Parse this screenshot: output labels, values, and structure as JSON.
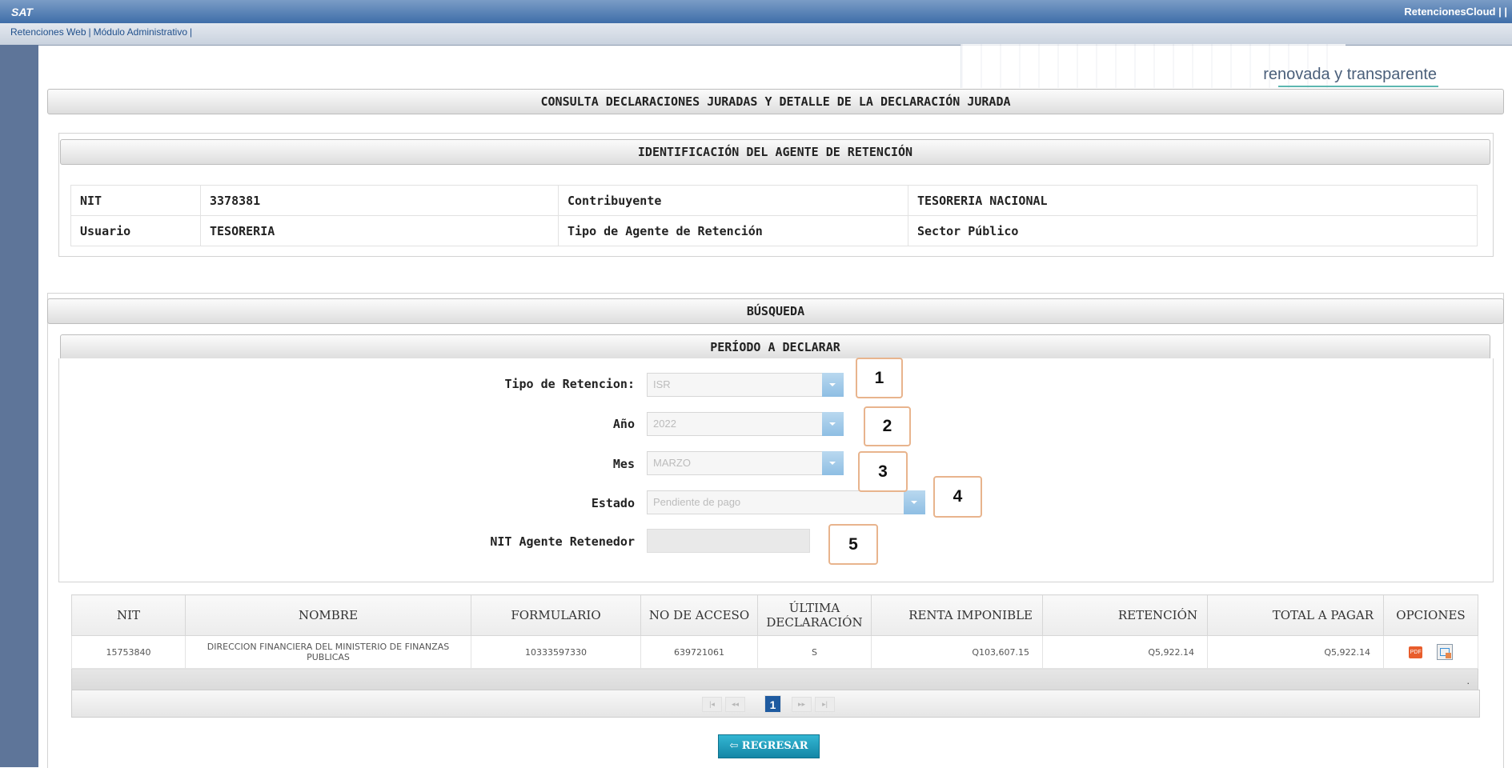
{
  "top": {
    "logo": "SAT",
    "app_name": "RetencionesCloud | |"
  },
  "nav": {
    "items": [
      "Retenciones Web",
      "Módulo Administrativo"
    ]
  },
  "header": {
    "slogan": "renovada y transparente"
  },
  "consulta": {
    "title": "CONSULTA DECLARACIONES JURADAS Y DETALLE DE LA DECLARACIÓN JURADA"
  },
  "identificacion": {
    "title": "IDENTIFICACIÓN DEL AGENTE DE RETENCIÓN",
    "rows": [
      {
        "l1": "NIT",
        "v1": "3378381",
        "l2": "Contribuyente",
        "v2": "TESORERIA NACIONAL"
      },
      {
        "l1": "Usuario",
        "v1": "TESORERIA",
        "l2": "Tipo de Agente de Retención",
        "v2": "Sector Público"
      }
    ]
  },
  "busqueda": {
    "title": "BÚSQUEDA",
    "periodo_title": "PERÍODO A DECLARAR",
    "tipo_label": "Tipo de Retencion:",
    "tipo_value": "ISR",
    "anio_label": "Año",
    "anio_value": "2022",
    "mes_label": "Mes",
    "mes_value": "MARZO",
    "estado_label": "Estado",
    "estado_value": "Pendiente de pago",
    "nit_label": "NIT Agente Retenedor",
    "nit_value": ""
  },
  "badges": [
    "1",
    "2",
    "3",
    "4",
    "5"
  ],
  "results": {
    "headers": [
      "NIT",
      "NOMBRE",
      "FORMULARIO",
      "NO DE ACCESO",
      "ÚLTIMA DECLARACIÓN",
      "RENTA IMPONIBLE",
      "RETENCIÓN",
      "TOTAL A PAGAR",
      "OPCIONES"
    ],
    "rows": [
      {
        "nit": "15753840",
        "nombre": "DIRECCION FINANCIERA DEL MINISTERIO DE FINANZAS PUBLICAS",
        "formulario": "10333597330",
        "acceso": "639721061",
        "ultima": "S",
        "renta": "Q103,607.15",
        "retencion": "Q5,922.14",
        "total": "Q5,922.14"
      }
    ],
    "footer_dot": "."
  },
  "pager": {
    "first": "|◂",
    "prev": "◂◂",
    "current": "1",
    "next": "▸▸",
    "last": "▸|"
  },
  "icons": {
    "pdf": "PDF"
  },
  "actions": {
    "back": "⇦ REGRESAR"
  }
}
